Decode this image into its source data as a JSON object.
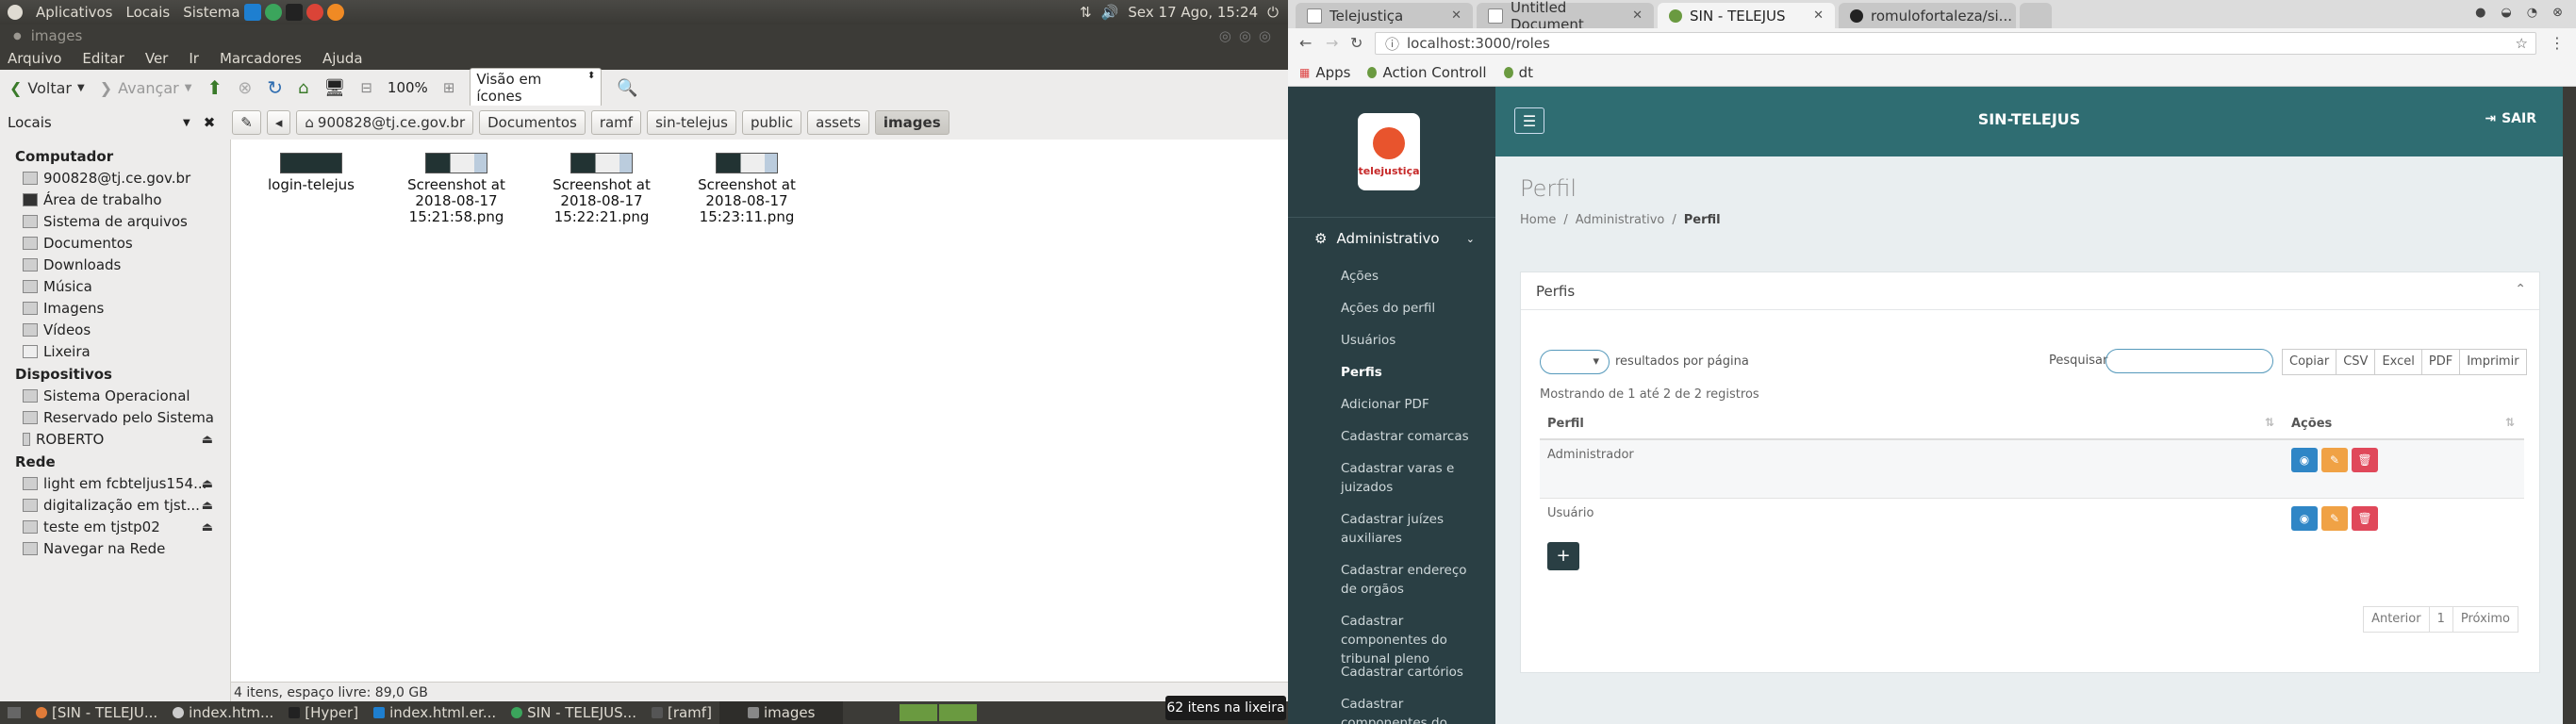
{
  "gnome_panel": {
    "menus": [
      "Aplicativos",
      "Locais",
      "Sistema"
    ],
    "clock": "Sex 17 Ago, 15:24"
  },
  "file_manager": {
    "window_title": "images",
    "menu": [
      "Arquivo",
      "Editar",
      "Ver",
      "Ir",
      "Marcadores",
      "Ajuda"
    ],
    "toolbar": {
      "back": "Voltar",
      "forward": "Avançar",
      "zoom": "100%",
      "view_mode": "Visão em ícones"
    },
    "sidebar_selector": "Locais",
    "breadcrumb": [
      "900828@tj.ce.gov.br",
      "Documentos",
      "ramf",
      "sin-telejus",
      "public",
      "assets",
      "images"
    ],
    "sidebar": [
      {
        "section": "Computador",
        "items": [
          {
            "label": "900828@tj.ce.gov.br",
            "icon": "home-folder-icon"
          },
          {
            "label": "Área de trabalho",
            "icon": "desktop-icon"
          },
          {
            "label": "Sistema de arquivos",
            "icon": "filesystem-icon"
          },
          {
            "label": "Documentos",
            "icon": "folder-icon"
          },
          {
            "label": "Downloads",
            "icon": "folder-icon"
          },
          {
            "label": "Música",
            "icon": "music-folder-icon"
          },
          {
            "label": "Imagens",
            "icon": "pictures-folder-icon"
          },
          {
            "label": "Vídeos",
            "icon": "videos-folder-icon"
          },
          {
            "label": "Lixeira",
            "icon": "trash-icon"
          }
        ]
      },
      {
        "section": "Dispositivos",
        "items": [
          {
            "label": "Sistema Operacional",
            "icon": "drive-icon"
          },
          {
            "label": "Reservado pelo Sistema",
            "icon": "drive-icon"
          },
          {
            "label": "ROBERTO",
            "icon": "usb-icon",
            "eject": true
          }
        ]
      },
      {
        "section": "Rede",
        "items": [
          {
            "label": "light em fcbteljus154...",
            "icon": "network-share-icon",
            "eject": true
          },
          {
            "label": "digitalização em tjst...",
            "icon": "network-share-icon",
            "eject": true
          },
          {
            "label": "teste em tjstp02",
            "icon": "network-share-icon",
            "eject": true
          },
          {
            "label": "Navegar na Rede",
            "icon": "network-icon"
          }
        ]
      }
    ],
    "files": [
      {
        "name": "login-telejus"
      },
      {
        "name": "Screenshot at 2018-08-17 15:21:58.png"
      },
      {
        "name": "Screenshot at 2018-08-17 15:22:21.png"
      },
      {
        "name": "Screenshot at 2018-08-17 15:23:11.png"
      }
    ],
    "status": "4 itens, espaço livre: 89,0 GB"
  },
  "taskbar": {
    "items": [
      "[SIN - TELEJU...",
      "index.htm...",
      "[Hyper]",
      "index.html.er...",
      "SIN - TELEJUS...",
      "[ramf]",
      "images"
    ],
    "trash_tooltip": "62 itens na lixeira"
  },
  "browser": {
    "tabs": [
      {
        "title": "Telejustiça",
        "active": false
      },
      {
        "title": "Untitled Document",
        "active": false
      },
      {
        "title": "SIN - TELEJUS",
        "active": true
      },
      {
        "title": "romulofortaleza/si...",
        "active": false
      }
    ],
    "url": "localhost:3000/roles",
    "bookmarks": [
      "Apps",
      "Action Controll",
      "dt"
    ]
  },
  "app": {
    "brand": "SIN-TELEJUS",
    "logout": "SAIR",
    "logo_text": "telejustiça",
    "sidebar_group": "Administrativo",
    "nav": [
      "Ações",
      "Ações do perfil",
      "Usuários",
      "Perfis",
      "Adicionar PDF",
      "Cadastrar comarcas",
      "Cadastrar varas e juizados",
      "Cadastrar juízes auxiliares",
      "Cadastrar endereço de orgãos",
      "Cadastrar componentes do tribunal pleno",
      "Cadastrar cartórios",
      "Cadastrar componentes do tribunal superior"
    ],
    "nav_active": "Perfis",
    "page_title": "Perfil",
    "breadcrumb": [
      "Home",
      "Administrativo",
      "Perfil"
    ],
    "panel_title": "Perfis",
    "length_label": "resultados por página",
    "search_label": "Pesquisar",
    "export_buttons": [
      "Copiar",
      "CSV",
      "Excel",
      "PDF",
      "Imprimir"
    ],
    "info": "Mostrando de 1 até 2 de 2 registros",
    "columns": [
      "Perfil",
      "Ações"
    ],
    "rows": [
      {
        "perfil": "Administrador"
      },
      {
        "perfil": "Usuário"
      }
    ],
    "pager": [
      "Anterior",
      "1",
      "Próximo"
    ],
    "colors": {
      "sidebar": "#2a3f44",
      "header": "#2f6d72",
      "view": "#2f86c6",
      "edit": "#f0a245",
      "delete": "#e0485a"
    }
  }
}
